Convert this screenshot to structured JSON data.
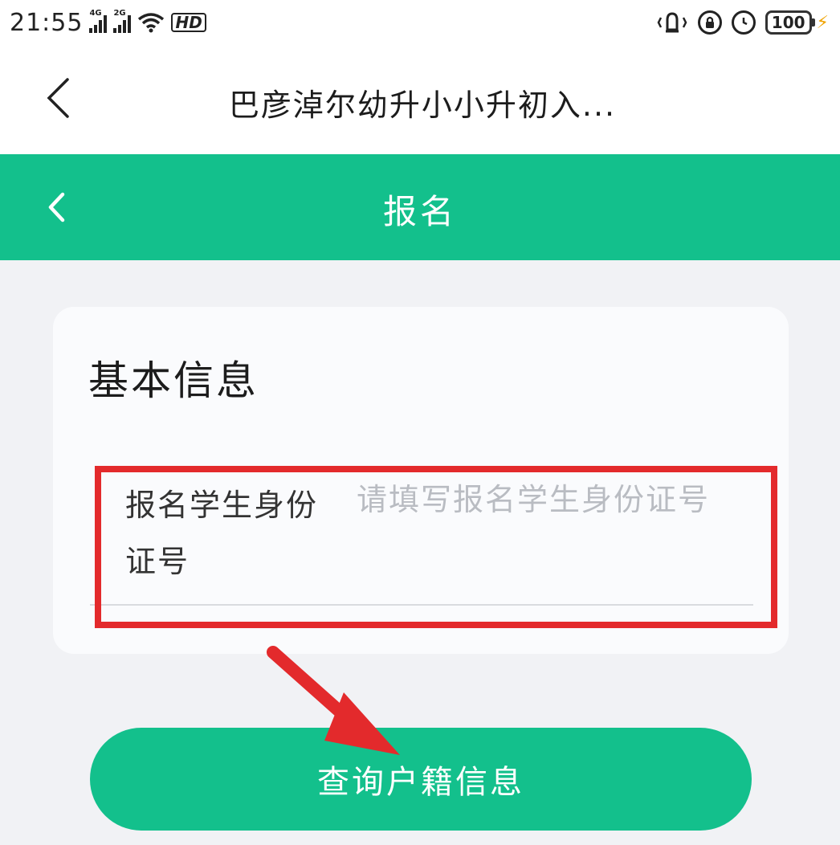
{
  "status_bar": {
    "time": "21:55",
    "network1": "4G",
    "network2": "2G",
    "hd": "HD",
    "battery": "100",
    "icons": [
      "signal-icon",
      "signal-icon",
      "wifi-icon",
      "vibrate-icon",
      "lock-rotation-icon",
      "alarm-icon",
      "battery-icon",
      "charging-icon"
    ]
  },
  "app_header": {
    "title": "巴彦淖尔幼升小小升初入..."
  },
  "page_header": {
    "title": "报名",
    "background": "#13c08c"
  },
  "form": {
    "section_title": "基本信息",
    "id_field": {
      "label": "报名学生身份证号",
      "placeholder": "请填写报名学生身份证号",
      "value": ""
    }
  },
  "actions": {
    "query_label": "查询户籍信息"
  },
  "annotation": {
    "highlight_color": "#e32a2c"
  }
}
